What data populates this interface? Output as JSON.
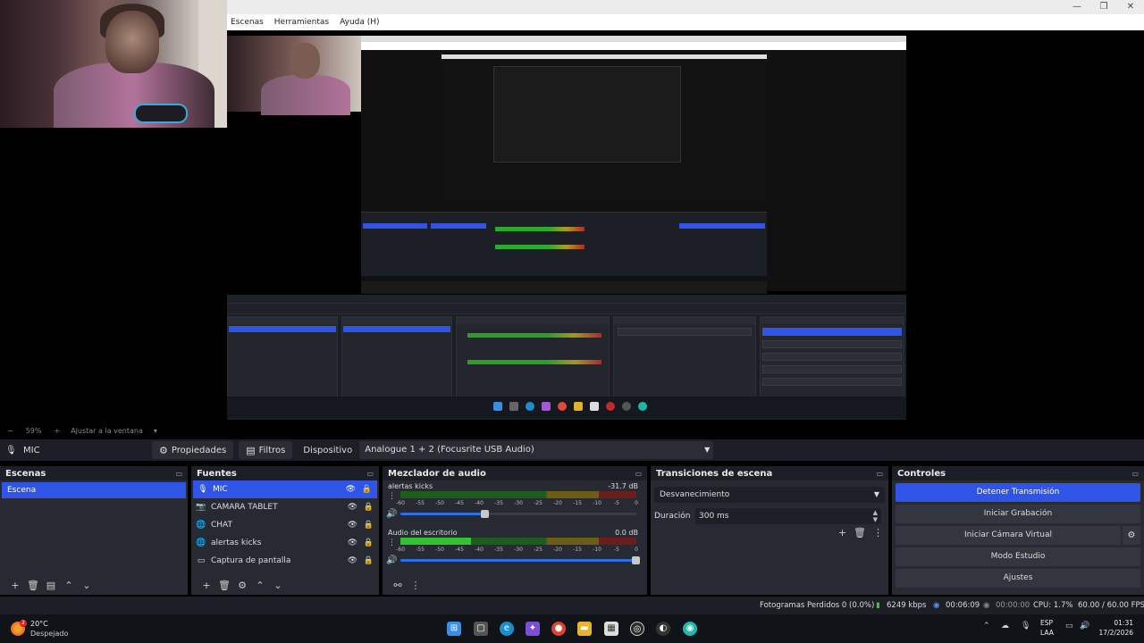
{
  "menu": {
    "items": [
      "Escenas",
      "Herramientas",
      "Ayuda (H)"
    ]
  },
  "zoom": {
    "percent": "59%",
    "fit_label": "Ajustar a la ventana"
  },
  "source_toolbar": {
    "source_name": "MIC",
    "properties_label": "Propiedades",
    "filters_label": "Filtros",
    "device_label": "Dispositivo",
    "device_value": "Analogue 1 + 2 (Focusrite USB Audio)"
  },
  "scenes": {
    "title": "Escenas",
    "items": [
      "Escena"
    ]
  },
  "sources": {
    "title": "Fuentes",
    "items": [
      {
        "name": "MIC",
        "icon": "microphone-icon",
        "selected": true
      },
      {
        "name": "CAMARA TABLET",
        "icon": "camera-icon",
        "selected": false
      },
      {
        "name": "CHAT",
        "icon": "globe-icon",
        "selected": false
      },
      {
        "name": "alertas kicks",
        "icon": "globe-icon",
        "selected": false
      },
      {
        "name": "Captura de pantalla",
        "icon": "monitor-icon",
        "selected": false
      }
    ]
  },
  "mixer": {
    "title": "Mezclador de audio",
    "ticks": [
      "-60",
      "-55",
      "-50",
      "-45",
      "-40",
      "-35",
      "-30",
      "-25",
      "-20",
      "-15",
      "-10",
      "-5",
      "0"
    ],
    "channels": [
      {
        "name": "alertas kicks",
        "db": "-31.7 dB",
        "level": 0,
        "volume": 0.36
      },
      {
        "name": "Audio del escritorio",
        "db": "0.0 dB",
        "level": 0.3,
        "volume": 1.0
      }
    ]
  },
  "transitions": {
    "title": "Transiciones de escena",
    "selected": "Desvanecimiento",
    "duration_label": "Duración",
    "duration_value": "300 ms"
  },
  "controls": {
    "title": "Controles",
    "stop_stream": "Detener Transmisión",
    "start_recording": "Iniciar Grabación",
    "start_virtual_cam": "Iniciar Cámara Virtual",
    "studio_mode": "Modo Estudio",
    "settings": "Ajustes"
  },
  "status": {
    "dropped_frames": "Fotogramas Perdidos 0 (0.0%)",
    "bitrate": "6249 kbps",
    "stream_time": "00:06:09",
    "record_time": "00:00:00",
    "cpu": "CPU: 1.7%",
    "fps": "60.00 / 60.00 FPS"
  },
  "taskbar": {
    "temperature": "20°C",
    "condition": "Despejado",
    "weather_badge": "2",
    "lang_top": "ESP",
    "lang_bottom": "LAA",
    "time": "01:31",
    "date": "17/2/2026"
  },
  "colors": {
    "accent": "#2f54e6",
    "panel": "#272a33",
    "header": "#1d1f27"
  }
}
